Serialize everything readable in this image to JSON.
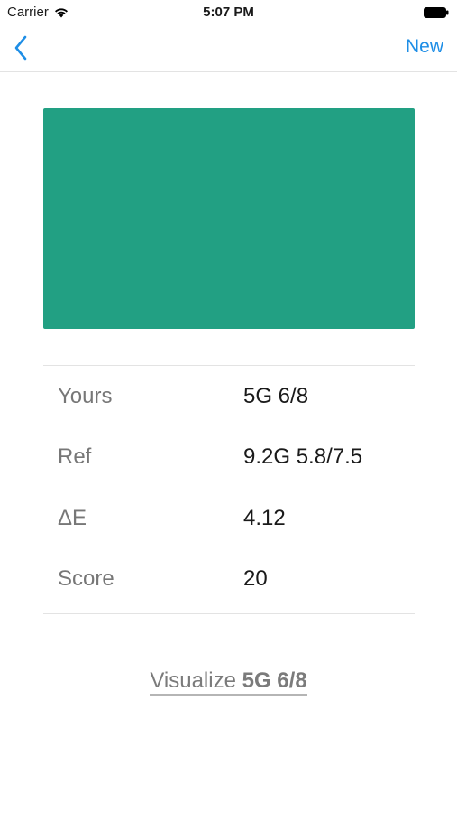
{
  "status_bar": {
    "carrier": "Carrier",
    "time": "5:07 PM",
    "wifi_icon": "wifi-icon",
    "battery_icon": "battery-icon"
  },
  "nav": {
    "back_icon": "chevron-left-icon",
    "new_label": "New",
    "accent_color": "#1e8ee6"
  },
  "swatch": {
    "color": "#22a083"
  },
  "results": [
    {
      "label": "Yours",
      "value": "5G 6/8"
    },
    {
      "label": "Ref",
      "value": "9.2G 5.8/7.5"
    },
    {
      "label": "ΔE",
      "value": "4.12"
    },
    {
      "label": "Score",
      "value": "20"
    }
  ],
  "visualize": {
    "prefix": "Visualize",
    "code": "5G 6/8"
  }
}
